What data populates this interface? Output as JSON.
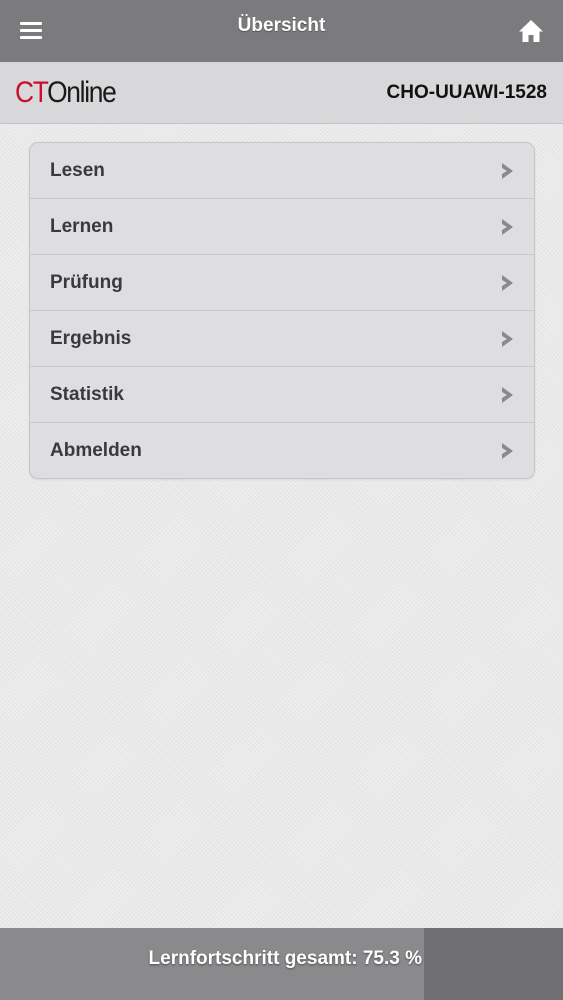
{
  "header": {
    "title": "Übersicht",
    "menu_icon": "hamburger-menu-icon",
    "home_icon": "home-icon",
    "background_color": "#7b7a7c"
  },
  "brand": {
    "logo_ct": "CT",
    "logo_online": "Online",
    "logo_ct_color": "#c8102e",
    "user_code": "CHO-UUAWI-1528"
  },
  "menu": {
    "items": [
      {
        "label": "Lesen",
        "icon": "chevron-right-icon"
      },
      {
        "label": "Lernen",
        "icon": "chevron-right-icon"
      },
      {
        "label": "Prüfung",
        "icon": "chevron-right-icon"
      },
      {
        "label": "Ergebnis",
        "icon": "chevron-right-icon"
      },
      {
        "label": "Statistik",
        "icon": "chevron-right-icon"
      },
      {
        "label": "Abmelden",
        "icon": "chevron-right-icon"
      }
    ]
  },
  "footer": {
    "progress_label": "Lernfortschritt gesamt: 75.3 %",
    "progress_percent": 75.3
  }
}
